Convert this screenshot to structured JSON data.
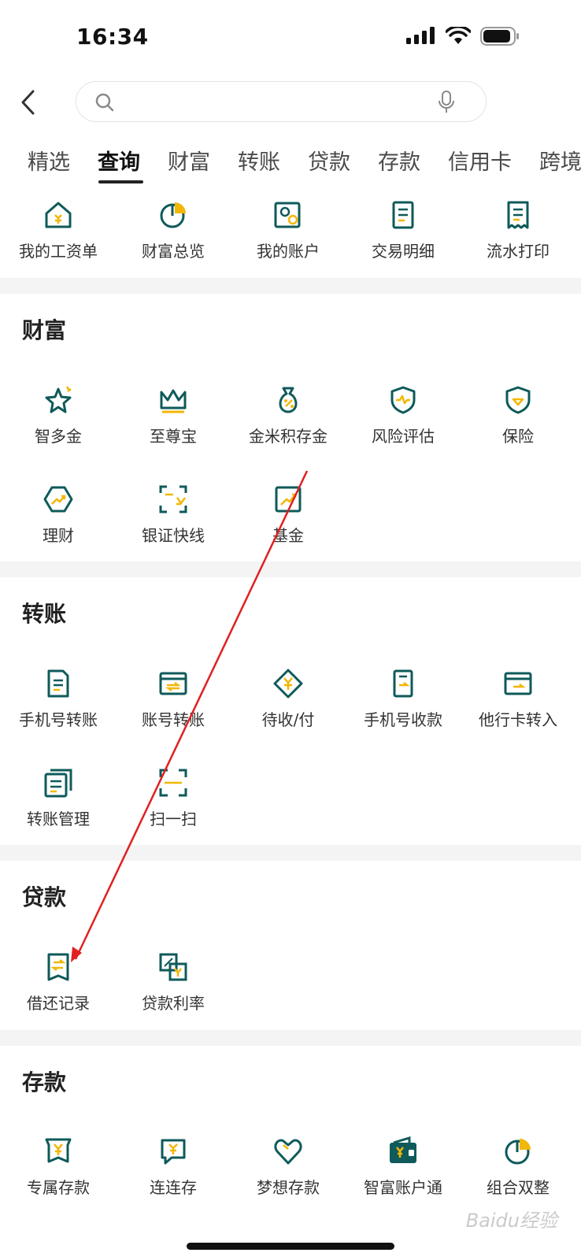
{
  "status_bar": {
    "time": "16:34"
  },
  "search": {
    "placeholder": ""
  },
  "tabs": [
    "精选",
    "查询",
    "财富",
    "转账",
    "贷款",
    "存款",
    "信用卡",
    "跨境"
  ],
  "quick_items": [
    "我的工资单",
    "财富总览",
    "我的账户",
    "交易明细",
    "流水打印"
  ],
  "sections": {
    "wealth": {
      "title": "财富",
      "items": [
        "智多金",
        "至尊宝",
        "金米积存金",
        "风险评估",
        "保险",
        "理财",
        "银证快线",
        "基金"
      ]
    },
    "transfer": {
      "title": "转账",
      "items": [
        "手机号转账",
        "账号转账",
        "待收/付",
        "手机号收款",
        "他行卡转入",
        "转账管理",
        "扫一扫"
      ]
    },
    "loan": {
      "title": "贷款",
      "items": [
        "借还记录",
        "贷款利率"
      ]
    },
    "deposit": {
      "title": "存款",
      "items": [
        "专属存款",
        "连连存",
        "梦想存款",
        "智富账户通",
        "组合双整"
      ]
    }
  },
  "watermark": "Baidu经验",
  "colors": {
    "icon_primary": "#0f5a5a",
    "icon_accent": "#f2b705",
    "annotation_arrow": "#e02020"
  }
}
